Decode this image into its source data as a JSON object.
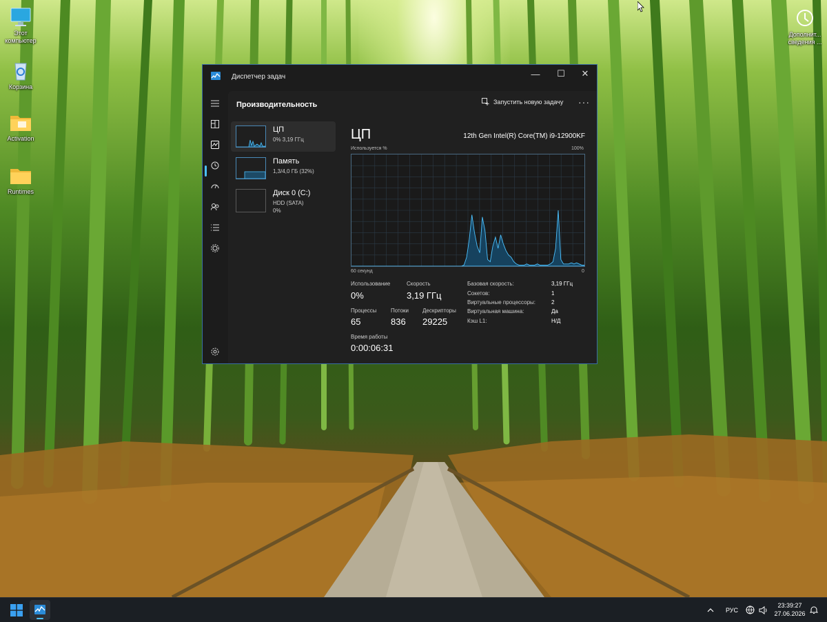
{
  "desktop": {
    "icons": [
      {
        "label_1": "Этот",
        "label_2": "компьютер",
        "icon": "computer-icon"
      },
      {
        "label_1": "Корзина",
        "icon": "recycle-bin-icon"
      },
      {
        "label_1": "Activation",
        "icon": "folder-icon"
      },
      {
        "label_1": "Runtimes",
        "icon": "folder-icon"
      },
      {
        "label_1": "Дополнит...",
        "label_2": "сведения ...",
        "icon": "help-info-icon"
      }
    ]
  },
  "window": {
    "title": "Диспетчер задач",
    "accent": "#4cc2ff",
    "controls": {
      "minimize": "—",
      "maximize": "☐",
      "close": "✕"
    }
  },
  "nav_rail": {
    "items": [
      "menu-icon",
      "processes-icon",
      "performance-icon",
      "app-history-icon",
      "startup-icon",
      "users-icon",
      "details-icon",
      "services-icon",
      "settings-icon"
    ],
    "active": "performance-icon"
  },
  "header": {
    "title": "Производительность",
    "run_task_label": "Запустить новую задачу",
    "more_label": "···"
  },
  "perf_list": [
    {
      "name": "ЦП",
      "sub_1": "0%  3,19 ГГц",
      "selected": true
    },
    {
      "name": "Память",
      "sub_1": "1,3/4,0 ГБ (32%)",
      "selected": false
    },
    {
      "name": "Диск 0 (C:)",
      "sub_1": "HDD (SATA)",
      "sub_2": "0%",
      "selected": false
    }
  ],
  "cpu": {
    "title": "ЦП",
    "model": "12th Gen Intel(R) Core(TM) i9-12900KF",
    "graph_label_top": "Используется %",
    "graph_label_max": "100%",
    "graph_label_time": "60 секунд",
    "graph_label_min": "0",
    "usage_samples": [
      0,
      0,
      0,
      0,
      0,
      0,
      0,
      0,
      0,
      0,
      0,
      0,
      0,
      0,
      0,
      0,
      0,
      0,
      0,
      0,
      0,
      0,
      0,
      0,
      0,
      0,
      0,
      0,
      0,
      0,
      0,
      0,
      0,
      0,
      0,
      0,
      0,
      0,
      0,
      0,
      0,
      0,
      0,
      1,
      8,
      24,
      46,
      30,
      18,
      12,
      44,
      32,
      6,
      4,
      18,
      26,
      16,
      28,
      20,
      14,
      10,
      8,
      4,
      2,
      1,
      1,
      1,
      2,
      1,
      1,
      1,
      2,
      1,
      1,
      1,
      1,
      2,
      4,
      16,
      50,
      6,
      2,
      2,
      2,
      3,
      2,
      3,
      2,
      1,
      1
    ],
    "usage_label": "Использование",
    "usage_value": "0%",
    "speed_label": "Скорость",
    "speed_value": "3,19 ГГц",
    "processes_label": "Процессы",
    "processes_value": "65",
    "threads_label": "Потоки",
    "threads_value": "836",
    "handles_label": "Дескрипторы",
    "handles_value": "29225",
    "uptime_label": "Время работы",
    "uptime_value": "0:00:06:31",
    "details": [
      {
        "k": "Базовая скорость:",
        "v": "3,19 ГГц"
      },
      {
        "k": "Сокетов:",
        "v": "1"
      },
      {
        "k": "Виртуальные процессоры:",
        "v": "2"
      },
      {
        "k": "Виртуальная машина:",
        "v": "Да"
      },
      {
        "k": "Кэш L1:",
        "v": "Н/Д"
      }
    ]
  },
  "taskbar": {
    "language": "РУС",
    "time": "23:39:27",
    "date": "27.06.2026"
  }
}
